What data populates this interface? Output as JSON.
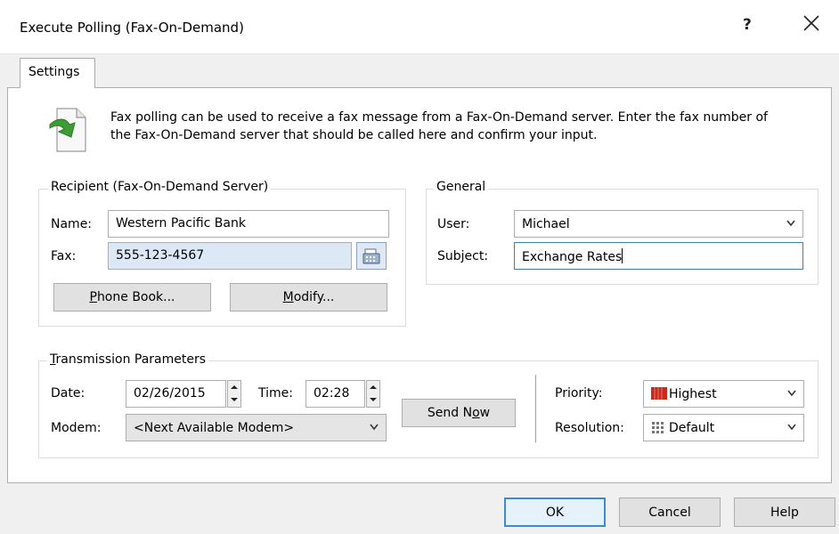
{
  "window": {
    "title": "Execute Polling (Fax-On-Demand)",
    "help_label": "?"
  },
  "tabs": [
    {
      "label": "Settings"
    }
  ],
  "info": {
    "text": "Fax polling can be used to receive a fax message from a Fax-On-Demand server. Enter the fax number of the Fax-On-Demand server that should be called here and confirm your input."
  },
  "recipient": {
    "group_label": "Recipient (Fax-On-Demand Server)",
    "name_label": "Name:",
    "name_value": "Western Pacific Bank",
    "fax_label": "Fax:",
    "fax_value": "555-123-4567",
    "phonebook_prefix": "",
    "phonebook_key": "P",
    "phonebook_rest": "hone Book...",
    "modify_key": "M",
    "modify_rest": "odify..."
  },
  "general": {
    "group_label": "General",
    "user_label": "User:",
    "user_value": "Michael",
    "subject_label": "Subject:",
    "subject_value": "Exchange Rates"
  },
  "transmission": {
    "group_key": "T",
    "group_rest": "ransmission Parameters",
    "date_label": "Date:",
    "date_value": "02/26/2015",
    "time_label": "Time:",
    "time_value": "02:28",
    "modem_label": "Modem:",
    "modem_value": "<Next Available Modem>",
    "send_now_prefix": "Send N",
    "send_now_key": "o",
    "send_now_rest": "w",
    "priority_label": "Priority:",
    "priority_value": "Highest",
    "resolution_label": "Resolution:",
    "resolution_value": "Default"
  },
  "buttons": {
    "ok": "OK",
    "cancel": "Cancel",
    "help": "Help"
  },
  "colors": {
    "accent": "#3b8ad5",
    "priority_icon": "#c62b1c",
    "icon_green": "#3e9b35"
  }
}
